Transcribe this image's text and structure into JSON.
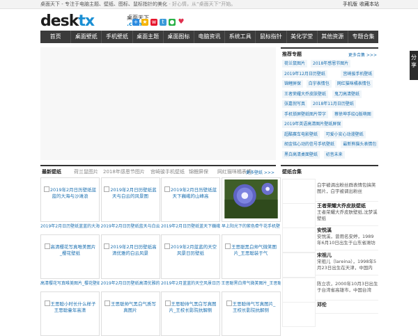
{
  "topbar": {
    "tagline": "桌面天下 - 专注于电脑主题、壁纸、图标、鼠标指针的美化",
    "mood": " - 好心情，从“桌面天下”开始。",
    "mobile": "手机版",
    "bookmark": "收藏本站"
  },
  "logo": {
    "part1": "desk",
    "part2": "tx",
    "cn": "桌面天下",
    "com": ".com"
  },
  "social_icons": [
    "plus-icon",
    "qzone-icon",
    "weibo-icon",
    "tencent-weibo-icon",
    "wechat-icon",
    "heart-icon"
  ],
  "nav": [
    "首页",
    "桌面壁纸",
    "手机壁纸",
    "桌面主题",
    "桌面图标",
    "电脑资讯",
    "系统工具",
    "鼠标指针",
    "美化学堂",
    "其他资源",
    "专题合集"
  ],
  "recommended": {
    "title": "推荐专题",
    "more": "更多合集 >>>",
    "chips": [
      [
        "荷兰鼠图片",
        "2018年感恩节图片"
      ],
      [
        "2019年12月日历壁纸",
        "宫崎骏手机壁纸"
      ],
      [
        "锦鲤屏保",
        "白宇表情包",
        "网红猫咪橘表情包"
      ],
      [
        "王者荣耀大乔皮肤壁纸",
        "鬼刀高清壁纸"
      ],
      [
        "张嘉倪写真",
        "2018年11月日历壁纸"
      ],
      [
        "手机锁屏壁纸图片带字",
        "蔡徐坤手绘Q版萌图"
      ],
      [
        "2019年英语高清图片壁纸屏保"
      ],
      [
        "超酷赛车电影壁纸",
        "可爱小安心动漫壁纸"
      ],
      [
        "胡金铭心动的信号手机壁纸",
        "最新熊猫头表情包"
      ],
      [
        "黑白高清桌面壁纸",
        "初音未来"
      ]
    ]
  },
  "latest": {
    "title": "最新壁纸",
    "tabs": [
      "荷兰鼠图片",
      "2018年感恩节图片",
      "宫崎骏手机壁纸",
      "锦鲤屏保",
      "网红猫咪橘表情"
    ],
    "more": "更多壁纸 >>>",
    "tiles": [
      {
        "alt": "2019年2月日历壁纸蓝蓝的大海与沙滩浪",
        "caption": "2019年2月日历壁纸蓝蓝的大海与"
      },
      {
        "alt": "2019年2月日历壁纸蓝天与白云的风景图",
        "caption": "2019年2月日历壁纸蓝天与白云的"
      },
      {
        "alt": "2019年2月日历壁纸蓝天下巍峨的山峰高",
        "caption": "2019年2月日历壁纸蓝天下巍峨的"
      },
      {
        "alt": "",
        "caption": "早上阳光下的紫色牵牛花手机壁"
      },
      {
        "alt": "高清樱花写真唯美图片_樱花壁纸",
        "caption": "高清樱花写真唯美图片_樱花壁纸"
      },
      {
        "alt": "2019年2月日历壁纸高清优雅的白云风景",
        "caption": "2019年2月日历壁纸高清优雅的白"
      },
      {
        "alt": "2019年2月蓝蓝的天空风景日历壁纸",
        "caption": "2019年2月蓝蓝的天空风景日历壁"
      },
      {
        "alt": "王思聪黑白帅气微笑图片_王思聪装于气",
        "caption": "王思聪黑白帅气微笑图片_王思聪"
      },
      {
        "alt": "王思聪小时长什么样子王思聪童年高清",
        "caption": ""
      },
      {
        "alt": "王思聪帅气黑白气质写真图片",
        "caption": ""
      },
      {
        "alt": "王思聪帅气黑白写真图片_王校长影院抗解侧",
        "caption": ""
      },
      {
        "alt": "王思聪帅气写真图片_王校长影院抗解侧",
        "caption": ""
      }
    ]
  },
  "collection": {
    "title": "壁纸合集",
    "items": [
      {
        "title": "",
        "desc": "白宇被调出粉丝群表情包搞笑图片，白宇被调出粉丝"
      },
      {
        "title": "王者荣耀大乔皮肤壁纸",
        "desc": "王者荣耀大乔皮肤壁纸,沈梦溪壁纸"
      },
      {
        "title": "安悦溪",
        "desc": "安悦溪，曾用名安婷，1989年6月10日出生于山东省潍坊"
      },
      {
        "title": "宋祖儿",
        "desc": "宋祖儿（lareina），1998年5月23日出生在天津，中国内"
      },
      {
        "title": "",
        "desc": "陈立农，2000年10月3日出生于台湾省高雄市，中国台湾"
      },
      {
        "title": "邓伦",
        "desc": ""
      }
    ]
  },
  "share": "分享",
  "colors": {
    "nav_bg": "#3b3b3b",
    "link": "#1a6fb0",
    "logo_blue": "#1a8fd4"
  }
}
